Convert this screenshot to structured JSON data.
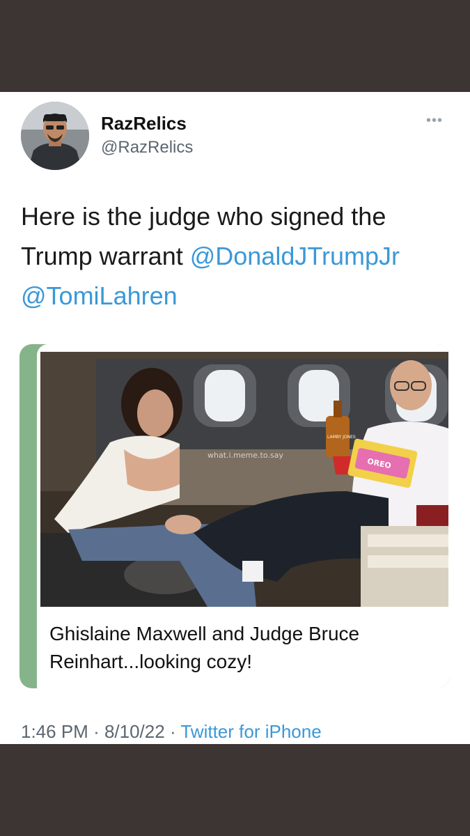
{
  "tweet": {
    "display_name": "RazRelics",
    "handle": "@RazRelics",
    "more_icon": "•••",
    "text_part1": "Here is the judge who signed the Trump warrant ",
    "mention1": "@DonaldJTrumpJr",
    "mention2": "@TomiLahren",
    "media_caption": "Ghislaine Maxwell and Judge Bruce Reinhart...looking cozy!",
    "watermark": "what.i.meme.to.say",
    "time": "1:46 PM",
    "date": "8/10/22",
    "source": "Twitter for iPhone",
    "bottle_label": "LAMBY JONES",
    "oreo_label": "OREO"
  },
  "colors": {
    "background": "#3d3533",
    "card": "#ffffff",
    "link": "#3a98d8",
    "muted": "#5b6670"
  }
}
